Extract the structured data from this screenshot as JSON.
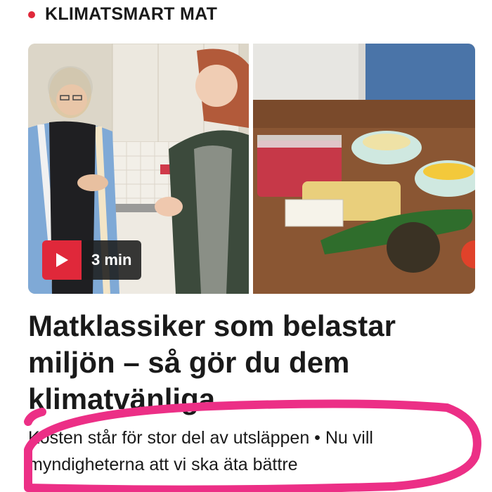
{
  "kicker": {
    "label": "KLIMATSMART MAT",
    "dot_color": "#e0283a",
    "dot_icon": "red-dot-icon"
  },
  "video": {
    "duration": "3 min",
    "play_icon": "play-icon",
    "badge_color": "#e0283a"
  },
  "article": {
    "headline": "Matklassiker som belastar miljön – så gör du dem klimatvänliga",
    "summary": "Kosten står för stor del av utsläppen • Nu vill myndigheterna att vi ska äta bättre"
  },
  "colors": {
    "accent": "#e0283a",
    "annotation": "#ec2f86",
    "text": "#1a1a1a"
  }
}
